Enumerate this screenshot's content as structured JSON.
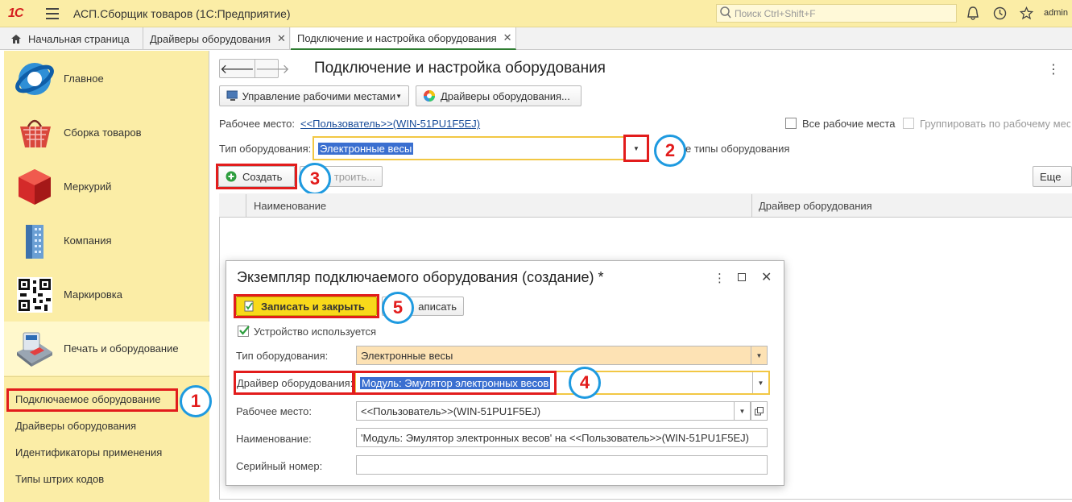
{
  "topbar": {
    "logo": "1С",
    "app_title": "АСП.Сборщик товаров  (1С:Предприятие)",
    "search_placeholder": "Поиск Ctrl+Shift+F",
    "user": "admin"
  },
  "tabs": [
    {
      "label": "Начальная страница"
    },
    {
      "label": "Драйверы оборудования"
    },
    {
      "label": "Подключение и настройка оборудования"
    }
  ],
  "sidebar": {
    "sections": [
      {
        "label": "Главное",
        "icon": "globe-icon"
      },
      {
        "label": "Сборка товаров",
        "icon": "basket-icon"
      },
      {
        "label": "Меркурий",
        "icon": "cube-icon"
      },
      {
        "label": "Компания",
        "icon": "building-icon"
      },
      {
        "label": "Маркировка",
        "icon": "qr-code-icon"
      },
      {
        "label": "Печать и оборудование",
        "icon": "card-terminal-icon"
      }
    ],
    "subitems": [
      {
        "label": "Подключаемое оборудование"
      },
      {
        "label": "Драйверы оборудования"
      },
      {
        "label": "Идентификаторы применения"
      },
      {
        "label": "Типы штрих кодов"
      }
    ]
  },
  "main": {
    "title": "Подключение и настройка оборудования",
    "workplaces_btn": "Управление рабочими местами",
    "drivers_btn": "Драйверы оборудования...",
    "workplace_label": "Рабочее место:",
    "workplace_value": "<<Пользователь>>(WIN-51PU1F5EJ)",
    "all_workplaces": "Все рабочие места",
    "group_by_workplace": "Группировать по рабочему мес",
    "equipment_type_label": "Тип оборудования:",
    "equipment_type_value": "Электронные весы",
    "all_types_suffix": "е типы оборудования",
    "create_btn": "Создать",
    "configure_btn": "троить...",
    "more_btn": "Еще",
    "col_name": "Наименование",
    "col_driver": "Драйвер оборудования"
  },
  "dialog": {
    "title": "Экземпляр подключаемого оборудования (создание) *",
    "save_close_btn": "Записать и закрыть",
    "save_btn": "аписать",
    "device_used": "Устройство используется",
    "type_label": "Тип оборудования:",
    "type_value": "Электронные весы",
    "driver_label": "Драйвер оборудования:",
    "driver_value": "Модуль: Эмулятор электронных весов",
    "workplace_label": "Рабочее место:",
    "workplace_value": "<<Пользователь>>(WIN-51PU1F5EJ)",
    "name_label": "Наименование:",
    "name_value": "'Модуль: Эмулятор электронных весов' на <<Пользователь>>(WIN-51PU1F5EJ)",
    "serial_label": "Серийный номер:",
    "serial_value": ""
  },
  "annotations": [
    "1",
    "2",
    "3",
    "4",
    "5"
  ],
  "colors": {
    "accent_red": "#e21c1c",
    "marker_blue": "#1e9ae0",
    "sidebar_bg": "#fbeda6",
    "save_yellow": "#f8d91a"
  }
}
